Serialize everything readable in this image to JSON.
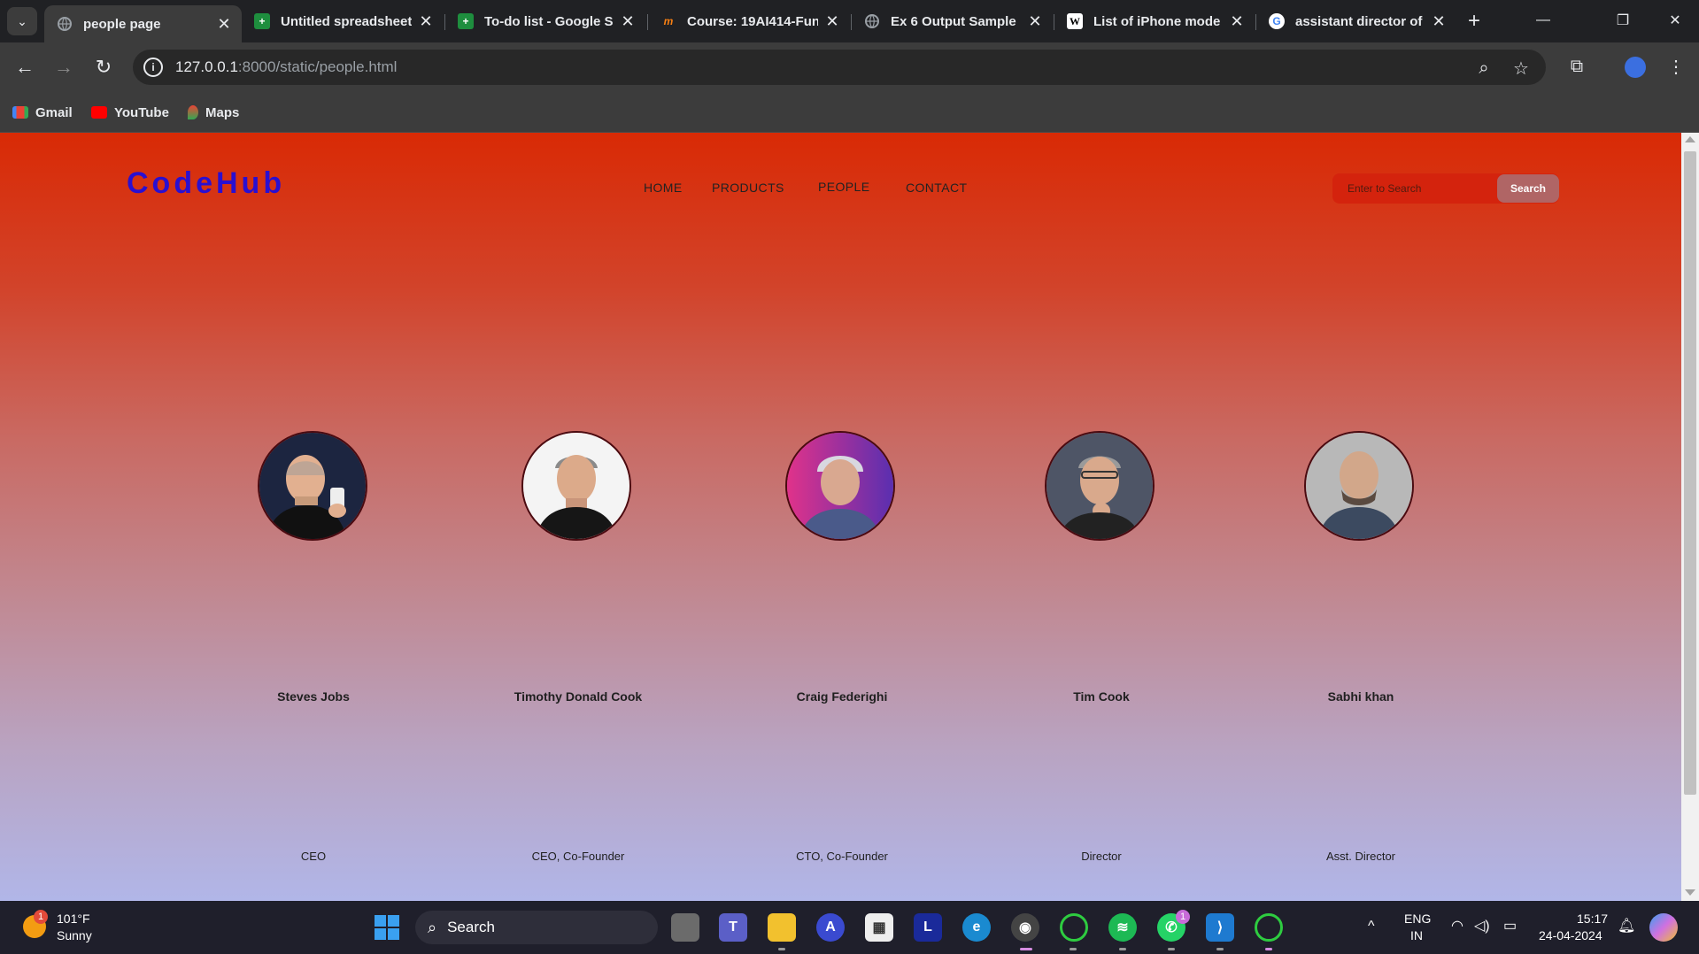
{
  "browser": {
    "tabs": [
      {
        "title": "people page",
        "active": true,
        "icon": "globe-icon"
      },
      {
        "title": "Untitled spreadsheet",
        "icon": "sheets-icon"
      },
      {
        "title": "To-do list - Google S",
        "icon": "sheets-icon"
      },
      {
        "title": "Course: 19AI414-Fun",
        "icon": "moodle-icon"
      },
      {
        "title": "Ex 6 Output Sample",
        "icon": "globe-icon"
      },
      {
        "title": "List of iPhone mode",
        "icon": "wikipedia-icon"
      },
      {
        "title": "assistant director of",
        "icon": "google-icon"
      }
    ],
    "url_host": "127.0.0.1",
    "url_rest": ":8000/static/people.html",
    "bookmarks": [
      {
        "label": "Gmail",
        "icon": "gmail-icon"
      },
      {
        "label": "YouTube",
        "icon": "youtube-icon"
      },
      {
        "label": "Maps",
        "icon": "maps-icon"
      }
    ]
  },
  "page": {
    "logo": "CodeHub",
    "nav": [
      "HOME",
      "PRODUCTS",
      "PEOPLE",
      "CONTACT"
    ],
    "search": {
      "placeholder": "Enter to Search",
      "button": "Search"
    },
    "people": [
      {
        "name": "Steves Jobs",
        "role": "CEO"
      },
      {
        "name": "Timothy Donald Cook",
        "role": "CEO, Co-Founder"
      },
      {
        "name": "Craig Federighi",
        "role": "CTO, Co-Founder"
      },
      {
        "name": "Tim Cook",
        "role": "Director"
      },
      {
        "name": "Sabhi khan",
        "role": "Asst. Director"
      }
    ],
    "colors": {
      "logo": "#2a0fd0",
      "gradient_top": "#d92a05",
      "gradient_bottom": "#b1b6e8"
    }
  },
  "taskbar": {
    "weather_temp": "101°F",
    "weather_desc": "Sunny",
    "weather_badge": "1",
    "search_label": "Search",
    "lang_1": "ENG",
    "lang_2": "IN",
    "time": "15:17",
    "date": "24-04-2024",
    "whatsapp_badge": "1"
  }
}
